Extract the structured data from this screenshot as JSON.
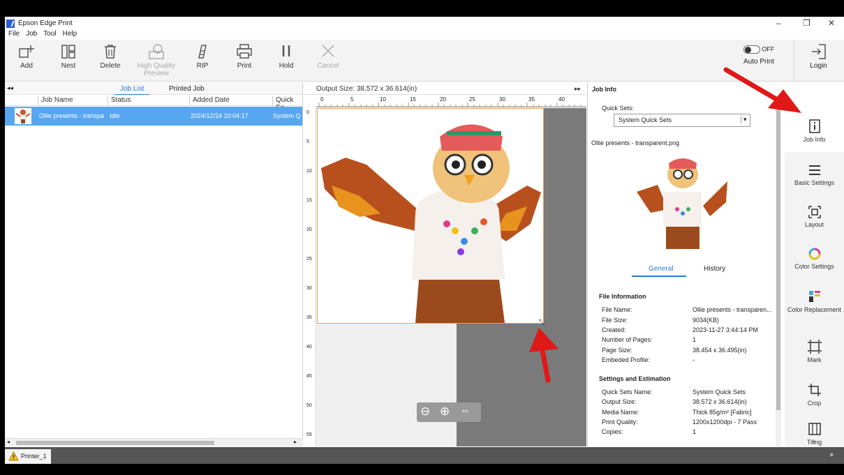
{
  "window": {
    "title": "Epson Edge Print"
  },
  "menu": [
    "File",
    "Job",
    "Tool",
    "Help"
  ],
  "toolbar": {
    "add": "Add",
    "nest": "Nest",
    "delete": "Delete",
    "hq_preview": "High Quality Preview",
    "rip": "RIP",
    "print": "Print",
    "hold": "Hold",
    "cancel": "Cancel",
    "auto_print_state": "OFF",
    "auto_print": "Auto Print",
    "login": "Login"
  },
  "job_tabs": {
    "job_list": "Job List",
    "printed_job": "Printed Job"
  },
  "job_columns": [
    "Job Name",
    "Status",
    "Added Date",
    "Quick Se"
  ],
  "jobs": [
    {
      "name": "Ollie presents - transpa",
      "status": "Idle",
      "added": "2024/12/24 10:04:17",
      "quick": "System Q"
    }
  ],
  "preview": {
    "output_size_label": "Output Size:",
    "output_size": "38.572 x 36.614(in)",
    "ruler_h": [
      "0",
      "5",
      "10",
      "15",
      "20",
      "25",
      "30",
      "35",
      "40"
    ],
    "ruler_v": [
      "0",
      "5",
      "10",
      "15",
      "20",
      "25",
      "30",
      "35",
      "40",
      "45",
      "50",
      "55"
    ]
  },
  "job_info": {
    "title": "Job Info",
    "quick_sets_label": "Quick Sets:",
    "quick_sets_value": "System Quick Sets",
    "filename": "Ollie presents - transparent.png",
    "tab_general": "General",
    "tab_history": "History",
    "file_info_title": "File Information",
    "file_info": [
      {
        "k": "File Name:",
        "v": "Ollie presents - transparen..."
      },
      {
        "k": "File Size:",
        "v": "9034(KB)"
      },
      {
        "k": "Created:",
        "v": "2023-11-27 3:44:14 PM"
      },
      {
        "k": "Number of Pages:",
        "v": "1"
      },
      {
        "k": "Page Size:",
        "v": "38.454 x 36.495(in)"
      },
      {
        "k": "Embeded Profile:",
        "v": "-"
      }
    ],
    "settings_title": "Settings and Estimation",
    "settings": [
      {
        "k": "Quick Sets Name:",
        "v": "System Quick Sets"
      },
      {
        "k": "Output Size:",
        "v": "38.572 x 36.614(in)"
      },
      {
        "k": "Media Name:",
        "v": "Thick 85g/m² [Fabric]"
      },
      {
        "k": "Print Quality:",
        "v": "1200x1200dpi - 7 Pass"
      },
      {
        "k": "Copies:",
        "v": "1"
      }
    ]
  },
  "side_nav": {
    "job_info": "Job Info",
    "basic": "Basic Settings",
    "layout": "Layout",
    "color": "Color Settings",
    "color_rep": "Color Replacement",
    "mark": "Mark",
    "crop": "Crop",
    "tiling": "Tiling"
  },
  "status": {
    "printer": "Printer_1"
  },
  "colors": {
    "accent": "#2a7ad0",
    "selection": "#57a6f0",
    "annotation": "#e01818",
    "print_area_border": "#e8a060"
  }
}
